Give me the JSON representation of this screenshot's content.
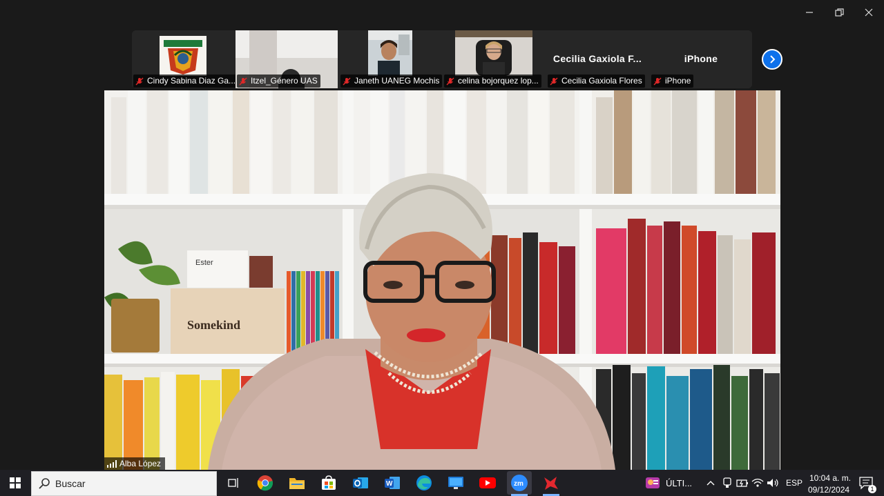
{
  "window_controls": {
    "minimize": "minimize",
    "restore": "restore",
    "close": "close"
  },
  "gallery": {
    "participants": [
      {
        "name": "Cindy Sabina Diaz Ga...",
        "muted": true,
        "has_video": true
      },
      {
        "name": "Itzel_Género UAS",
        "muted": true,
        "has_video": true
      },
      {
        "name": "Janeth UANEG Mochis",
        "muted": true,
        "has_video": true
      },
      {
        "name": "celina bojorquez lop...",
        "muted": true,
        "has_video": true
      },
      {
        "name": "Cecilia Gaxiola Flores",
        "display_name": "Cecilia  Gaxiola  F...",
        "muted": true,
        "has_video": false
      },
      {
        "name": "iPhone",
        "display_name": "iPhone",
        "muted": true,
        "has_video": false
      }
    ],
    "next_page_icon": "chevron-right-icon"
  },
  "main_speaker": {
    "name": "Alba López",
    "signal_icon": "signal-bars-icon",
    "book_box_label": "Somekind",
    "book_ester": "Ester"
  },
  "taskbar": {
    "search_placeholder": "Buscar",
    "pinned": [
      "task-view",
      "chrome",
      "file-explorer",
      "microsoft-store",
      "outlook",
      "word",
      "edge",
      "remote-desktop",
      "youtube",
      "zoom",
      "zoom-meeting"
    ],
    "notification_app_label": "ÚLTI...",
    "language": "ESP",
    "time": "10:04 a. m.",
    "date": "09/12/2024",
    "notification_count": "1"
  },
  "colors": {
    "accent_blue": "#0e71eb",
    "mute_red": "#e02828",
    "zoom_blue": "#2d8cff"
  }
}
